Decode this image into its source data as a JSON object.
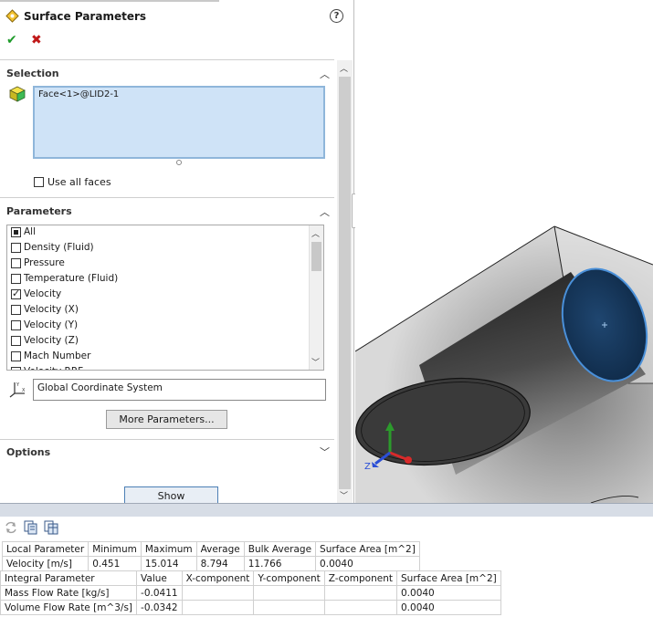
{
  "panel": {
    "title": "Surface Parameters",
    "help_glyph": "?",
    "ok_glyph": "✔",
    "cancel_glyph": "✖",
    "selection": {
      "title": "Selection",
      "face": "Face<1>@LID2-1",
      "use_all_faces_label": "Use all faces",
      "use_all_faces_checked": false
    },
    "parameters": {
      "title": "Parameters",
      "items": [
        {
          "label": "All",
          "state": "partial"
        },
        {
          "label": "Density (Fluid)",
          "state": "off"
        },
        {
          "label": "Pressure",
          "state": "off"
        },
        {
          "label": "Temperature (Fluid)",
          "state": "off"
        },
        {
          "label": "Velocity",
          "state": "checked"
        },
        {
          "label": "Velocity (X)",
          "state": "off"
        },
        {
          "label": "Velocity (Y)",
          "state": "off"
        },
        {
          "label": "Velocity (Z)",
          "state": "off"
        },
        {
          "label": "Mach Number",
          "state": "off"
        },
        {
          "label": "Velocity RRF",
          "state": "off"
        }
      ],
      "coordinate_system": "Global Coordinate System",
      "more_button": "More Parameters..."
    },
    "options": {
      "title": "Options",
      "show_button": "Show"
    }
  },
  "viewport": {
    "triad": {
      "z_label": "Z"
    }
  },
  "results": {
    "local_table": {
      "headers": [
        "Local Parameter",
        "Minimum",
        "Maximum",
        "Average",
        "Bulk Average",
        "Surface Area [m^2]"
      ],
      "rows": [
        [
          "Velocity [m/s]",
          "0.451",
          "15.014",
          "8.794",
          "11.766",
          "0.0040"
        ]
      ]
    },
    "integral_table": {
      "headers": [
        "Integral Parameter",
        "Value",
        "X-component",
        "Y-component",
        "Z-component",
        "Surface Area [m^2]"
      ],
      "rows": [
        [
          "Mass Flow Rate [kg/s]",
          "-0.0411",
          "",
          "",
          "",
          "0.0040"
        ],
        [
          "Volume Flow Rate [m^3/s]",
          "-0.0342",
          "",
          "",
          "",
          "0.0040"
        ]
      ]
    }
  },
  "colors": {
    "accent": "#1e9b2a",
    "cancel": "#c01818",
    "selection_fill": "#cfe3f7",
    "selected_face": "#1a3f66"
  }
}
